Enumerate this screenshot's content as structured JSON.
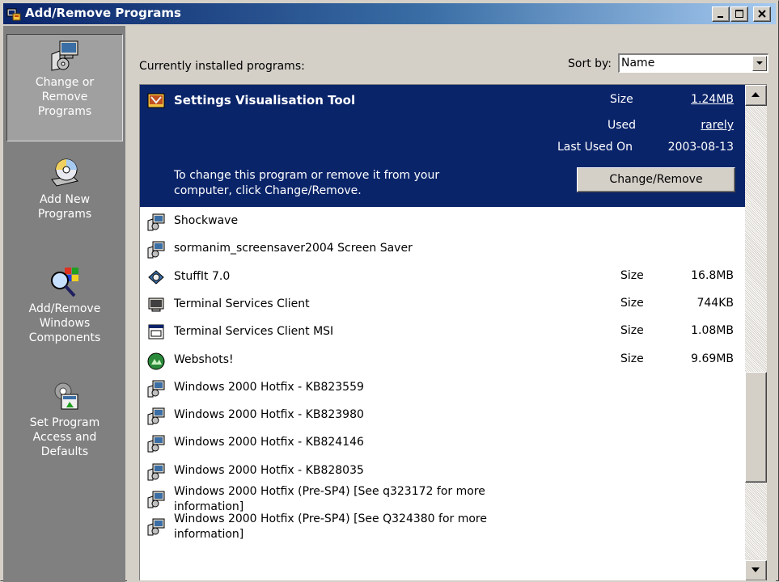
{
  "window": {
    "title": "Add/Remove Programs",
    "icon": "add-remove-programs-icon",
    "controls": {
      "minimize": "minimize-icon",
      "maximize": "maximize-icon",
      "close": "close-icon"
    }
  },
  "sidebar": {
    "items": [
      {
        "label": "Change or\nRemove\nPrograms",
        "icon": "change-remove-programs-icon",
        "active": true
      },
      {
        "label": "Add New\nPrograms",
        "icon": "cd-install-icon",
        "active": false
      },
      {
        "label": "Add/Remove\nWindows\nComponents",
        "icon": "windows-components-icon",
        "active": false
      },
      {
        "label": "Set Program\nAccess and\nDefaults",
        "icon": "program-defaults-icon",
        "active": false
      }
    ]
  },
  "header": {
    "currently_installed": "Currently installed programs:",
    "sort_by_label": "Sort by:",
    "sort_by_value": "Name"
  },
  "selected_program": {
    "name": "Settings Visualisation Tool",
    "size_label": "Size",
    "size": "1.24MB",
    "used_label": "Used",
    "used": "rarely",
    "last_used_label": "Last Used On",
    "last_used": "2003-08-13",
    "description": "To change this program or remove it from your\ncomputer, click Change/Remove.",
    "button": "Change/Remove"
  },
  "programs": [
    {
      "name": "Shockwave",
      "size_label": "",
      "size": "",
      "icon": "installer-icon"
    },
    {
      "name": "sormanim_screensaver2004 Screen Saver",
      "size_label": "",
      "size": "",
      "icon": "installer-icon"
    },
    {
      "name": "StuffIt 7.0",
      "size_label": "Size",
      "size": "16.8MB",
      "icon": "stuffit-icon"
    },
    {
      "name": "Terminal Services Client",
      "size_label": "Size",
      "size": "744KB",
      "icon": "terminal-client-icon"
    },
    {
      "name": "Terminal Services Client MSI",
      "size_label": "Size",
      "size": "1.08MB",
      "icon": "window-icon"
    },
    {
      "name": "Webshots!",
      "size_label": "Size",
      "size": "9.69MB",
      "icon": "webshots-icon"
    },
    {
      "name": "Windows 2000 Hotfix - KB823559",
      "size_label": "",
      "size": "",
      "icon": "installer-icon"
    },
    {
      "name": "Windows 2000 Hotfix - KB823980",
      "size_label": "",
      "size": "",
      "icon": "installer-icon"
    },
    {
      "name": "Windows 2000 Hotfix - KB824146",
      "size_label": "",
      "size": "",
      "icon": "installer-icon"
    },
    {
      "name": "Windows 2000 Hotfix - KB828035",
      "size_label": "",
      "size": "",
      "icon": "installer-icon"
    },
    {
      "name": "Windows 2000 Hotfix (Pre-SP4) [See q323172 for more\ninformation]",
      "size_label": "",
      "size": "",
      "icon": "installer-icon"
    },
    {
      "name": "Windows 2000 Hotfix (Pre-SP4) [See Q324380 for more\ninformation]",
      "size_label": "",
      "size": "",
      "icon": "installer-icon"
    }
  ],
  "scrollbar": {
    "up": "scroll-up-arrow-icon",
    "down": "scroll-down-arrow-icon"
  }
}
